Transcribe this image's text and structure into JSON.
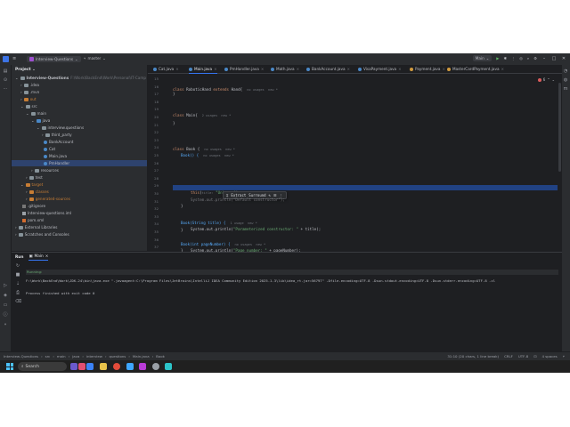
{
  "titlebar": {
    "menu_icon": "hamburger-icon",
    "project_badge": "IQ",
    "project_name": "Interview-Questions",
    "branch": "master",
    "run_config": "Main"
  },
  "project_panel": {
    "title": "Project",
    "root_label": "Interview-Questions",
    "root_path": "F:\\Work\\BackEnd\\Work\\Personal\\IT-Camp",
    "items": [
      {
        "label": ".idea",
        "kind": "folder"
      },
      {
        "label": ".mvn",
        "kind": "folder"
      },
      {
        "label": "out",
        "kind": "folder-orange"
      },
      {
        "label": "src",
        "kind": "folder"
      },
      {
        "label": "main",
        "kind": "folder"
      },
      {
        "label": "java",
        "kind": "folder-blue"
      },
      {
        "label": "interview.questions",
        "kind": "folder"
      },
      {
        "label": "third_party",
        "kind": "folder"
      },
      {
        "label": "BankAccount",
        "kind": "class"
      },
      {
        "label": "Cat",
        "kind": "class"
      },
      {
        "label": "Main.java",
        "kind": "class"
      },
      {
        "label": "PmHandler",
        "kind": "class"
      },
      {
        "label": "resources",
        "kind": "folder"
      },
      {
        "label": "test",
        "kind": "folder"
      },
      {
        "label": "target",
        "kind": "folder-orange"
      },
      {
        "label": "classes",
        "kind": "folder-orange"
      },
      {
        "label": "generated-sources",
        "kind": "folder-orange"
      },
      {
        "label": ".gitignore",
        "kind": "git"
      },
      {
        "label": "Interview-questions.iml",
        "kind": "jar"
      },
      {
        "label": "pom.xml",
        "kind": "xml"
      },
      {
        "label": "External Libraries",
        "kind": "folder"
      },
      {
        "label": "Scratches and Consoles",
        "kind": "folder"
      }
    ]
  },
  "editor": {
    "tabs": [
      "Cat.java",
      "Main.java",
      "PmHandler.java",
      "Math.java",
      "BankAccount.java",
      "VisaPayment.java",
      "Payment.java",
      "MasterCardPayment.java"
    ],
    "active_tab": "Main.java",
    "error_count": "6",
    "line_numbers": [
      "15",
      "16",
      "17",
      "18",
      "19",
      "20",
      "21",
      "22",
      "23",
      "24",
      "25",
      "26",
      "27",
      "28",
      "29",
      "30",
      "31",
      "32",
      "33",
      "34",
      "35",
      "36",
      "37"
    ],
    "code": {
      "l16_kw": "class",
      "l16_name": "RoboticHand",
      "l16_kw2": "extends",
      "l16_rest": "Hand{",
      "l16_hint": "no usages  new *",
      "l18": "}",
      "l20_kw": "class",
      "l20_rest": "Main{",
      "l20_hint": "2 usages  new *",
      "l22": "}",
      "l25_kw": "class",
      "l25_name": "Book {",
      "l25_hint": "no usages  new *",
      "l26_fn": "Book() {",
      "l26_hint": "no usages  new *",
      "l27_fn": "this",
      "l27_hint": "title:",
      "l27_str": "\"Unknown\"",
      "l27_end": ");",
      "l28": "System.out.println(\"Default constructor\");",
      "l29": "}",
      "l31_fn": "Book(String title) {",
      "l31_hint": "1 usage  new *",
      "l32_pre": "System.out.println(",
      "l32_str": "\"Parameterized constructor: \"",
      "l32_post": " + title);",
      "l33": "}",
      "l35_fn": "Book(int pageNumber) {",
      "l35_hint": "no usages  new *",
      "l36_pre": "System.out.println(",
      "l36_str": "\"Page number: \"",
      "l36_post": " + pageNumber);",
      "l37": "}",
      "l38": "}"
    },
    "popup": {
      "extract": "Extract",
      "surround": "Surround"
    }
  },
  "run_panel": {
    "title": "Run",
    "tab": "Main",
    "running_label": "Running:",
    "command": "F:\\Work\\BackEnd\\Work\\JDK-24\\bin\\java.exe \"-javaagent:C:\\Program Files\\JetBrains\\IntelliJ IDEA Community Edition 2025.1.3\\lib\\idea_rt.jar=56797\" -Dfile.encoding=UTF-8 -Dsun.stdout.encoding=UTF-8 -Dsun.stderr.encoding=UTF-8 -cl",
    "finished": "Process finished with exit code 0"
  },
  "statusbar": {
    "crumbs": [
      "Interview-Questions",
      "src",
      "main",
      "java",
      "interview",
      "questions",
      "Main.java",
      "Book"
    ],
    "position": "31:10 (20 chars, 1 line break)",
    "line_sep": "CRLF",
    "encoding": "UTF-8",
    "indent": "4 spaces"
  },
  "taskbar": {
    "search_label": "Search"
  },
  "colors": {
    "ide_bg": "#1e1f22",
    "panel_bg": "#2b2d30",
    "keyword": "#cf8e6d",
    "string": "#6aab73",
    "function": "#56a8f5",
    "selection": "#214283",
    "accent": "#3574f0"
  }
}
